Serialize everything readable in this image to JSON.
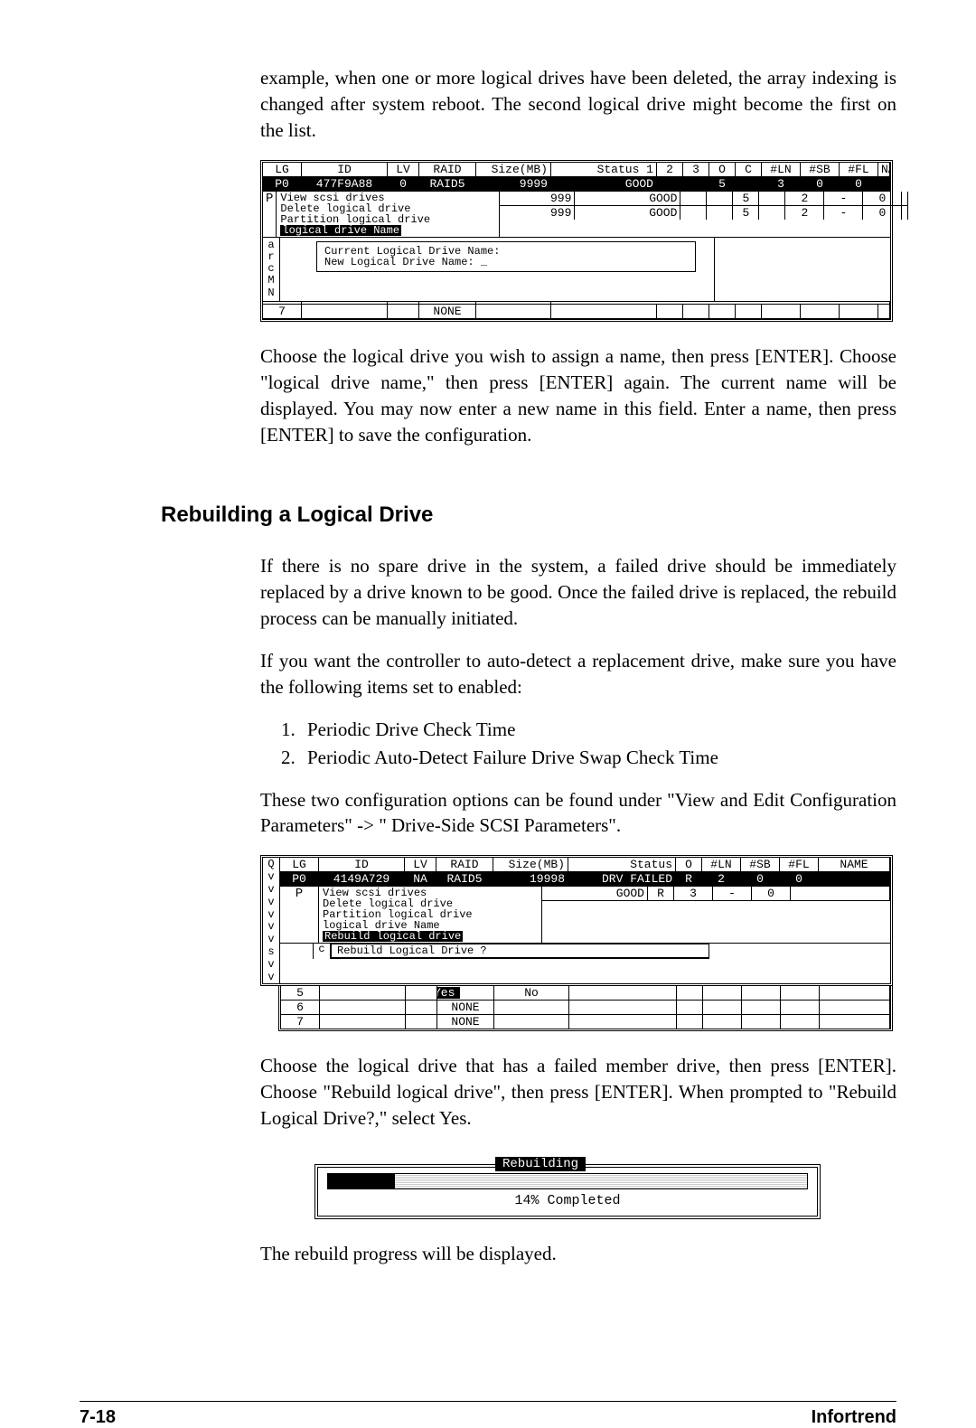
{
  "intro_para": "example, when one or more logical drives have been deleted, the array indexing is changed after system reboot.  The second logical drive might become the first on the list.",
  "screenshot1": {
    "headers": [
      "LG",
      "ID",
      "LV",
      "RAID",
      "Size(MB)",
      "Status 1",
      "2",
      "3",
      "O",
      "C",
      "#LN",
      "#SB",
      "#FL",
      "NAME"
    ],
    "row0": [
      "P0",
      "477F9A88",
      "0",
      "RAID5",
      "9999",
      "GOOD",
      "",
      "",
      "5",
      "",
      "3",
      "0",
      "0",
      ""
    ],
    "row1": [
      "P",
      "",
      "",
      "",
      "999",
      "GOOD",
      "",
      "",
      "5",
      "",
      "2",
      "-",
      "0",
      ""
    ],
    "row2": [
      "P",
      "",
      "",
      "",
      "999",
      "GOOD",
      "",
      "",
      "5",
      "",
      "2",
      "-",
      "0",
      ""
    ],
    "menu": [
      "View scsi drives",
      "Delete logical drive",
      "Partition logical drive",
      "logical drive Name"
    ],
    "name_prompt1": "Current Logical Drive Name:",
    "name_prompt2": "    New Logical Drive Name: _",
    "sidebar": "arcMN",
    "none_row": [
      "7",
      "",
      "",
      "NONE",
      "",
      "",
      "",
      "",
      "",
      "",
      "",
      "",
      "",
      ""
    ]
  },
  "para_after_ss1": "Choose the logical drive you wish to assign a name, then press [ENTER].  Choose \"logical drive name,\" then press [ENTER] again.  The current name will be displayed.  You may now enter a new name in this field.  Enter a name, then press [ENTER] to save the configuration.",
  "heading2": "Rebuilding a Logical Drive",
  "rebuild_p1": "If there is no spare drive in the system, a failed drive should be immediately replaced by a drive known to be good.  Once the failed drive is replaced, the rebuild process can be manually initiated.",
  "rebuild_p2": "If you want the controller to auto-detect a replacement drive, make sure you have the following items set to enabled:",
  "rebuild_list": [
    "Periodic Drive Check Time",
    "Periodic Auto-Detect Failure Drive Swap Check Time"
  ],
  "rebuild_p3": "These two configuration options can be found under \"View and Edit Configuration Parameters\" -> \" Drive-Side SCSI Parameters\".",
  "screenshot2": {
    "side_letters": "Qvvvvvvsvv",
    "headers": [
      "LG",
      "ID",
      "LV",
      "RAID",
      "Size(MB)",
      "Status",
      "O",
      "#LN",
      "#SB",
      "#FL",
      "NAME"
    ],
    "row0": [
      "P0",
      "4149A729",
      "NA",
      "RAID5",
      "19998",
      "DRV FAILED",
      "R",
      "2",
      "0",
      "0",
      ""
    ],
    "row1": [
      "P",
      "",
      "",
      "",
      "",
      "GOOD",
      "R",
      "3",
      "-",
      "0",
      ""
    ],
    "menu": [
      "View scsi drives",
      "Delete logical drive",
      "Partition logical drive",
      "logical drive Name",
      "Rebuild logical drive"
    ],
    "confirm_q": "Rebuild Logical Drive ?",
    "confirm_yes": "Yes",
    "confirm_no": "No",
    "rows_after": [
      [
        "5",
        "",
        "",
        "",
        "",
        "",
        "",
        "",
        "",
        "",
        ""
      ],
      [
        "6",
        "",
        "",
        "NONE",
        "",
        "",
        "",
        "",
        "",
        "",
        ""
      ],
      [
        "7",
        "",
        "",
        "NONE",
        "",
        "",
        "",
        "",
        "",
        "",
        ""
      ]
    ]
  },
  "para_after_ss2": "Choose the logical drive that has a failed member drive, then press [ENTER].  Choose \"Rebuild logical drive\", then press [ENTER].  When prompted to \"Rebuild Logical Drive?,\" select Yes.",
  "rebuilding_title": "Rebuilding",
  "rebuilding_percent": "14% Completed",
  "para_final": "The rebuild progress will be displayed.",
  "footer_page": "7-18",
  "footer_brand": "Infortrend"
}
